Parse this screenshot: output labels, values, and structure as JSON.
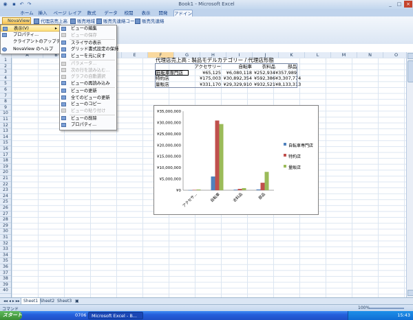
{
  "window": {
    "title": "Book1 - Microsoft Excel",
    "minimize_icon": "minimize-icon",
    "maximize_icon": "maximize-icon",
    "close_icon": "close-icon"
  },
  "ribbon_tabs": [
    "ホーム",
    "挿入",
    "ページ レイアウト",
    "数式",
    "データ",
    "校閲",
    "表示",
    "開発",
    "アドイン"
  ],
  "active_tab": "アドイン",
  "ribbon": {
    "novaview_button": "NovaView",
    "buttons": [
      "代理店売上高",
      "販売地域",
      "販売先連絡コード",
      "販売先連絡"
    ]
  },
  "menu_main": {
    "items": [
      {
        "label": "表示(V)",
        "has_submenu": true,
        "disabled": false
      },
      {
        "label": "プロパティ...",
        "has_submenu": false,
        "disabled": false
      },
      {
        "label": "クライアントのアップデート...",
        "has_submenu": false,
        "disabled": false
      },
      {
        "label": "NovaView のヘルプ",
        "has_submenu": false,
        "disabled": false
      }
    ]
  },
  "menu_sub": {
    "items": [
      {
        "label": "ビューの編集",
        "disabled": false
      },
      {
        "label": "ビューの保存",
        "disabled": true
      },
      {
        "label": "スライサの表示",
        "disabled": false
      },
      {
        "label": "グリッド書式設定の保持",
        "disabled": false
      },
      {
        "label": "ビューを元に戻す",
        "disabled": false
      },
      {
        "label": "パラメータ...",
        "disabled": true
      },
      {
        "label": "次の行を読み込む...",
        "disabled": true
      },
      {
        "label": "グラフの自動選択",
        "disabled": true
      },
      {
        "label": "ビューの再読み込み",
        "disabled": false
      },
      {
        "label": "ビューの更新",
        "disabled": false
      },
      {
        "label": "全てのビューの更新",
        "disabled": false
      },
      {
        "label": "ビューのコピー",
        "disabled": false
      },
      {
        "label": "ビューの貼り付け",
        "disabled": true
      },
      {
        "label": "ビューの削除",
        "disabled": false
      },
      {
        "label": "プロパティ...",
        "disabled": false
      }
    ]
  },
  "columns": [
    "A",
    "B",
    "C",
    "D",
    "E",
    "F",
    "G",
    "H",
    "I",
    "J",
    "K",
    "L",
    "M",
    "N",
    "O"
  ],
  "selected_column": "F",
  "rows": [
    "1",
    "2",
    "3",
    "4",
    "5",
    "6",
    "7",
    "8",
    "9",
    "10",
    "11",
    "12",
    "13",
    "14",
    "15",
    "16",
    "17",
    "18",
    "19",
    "20",
    "21",
    "22",
    "23",
    "24",
    "25",
    "26",
    "27",
    "28",
    "29",
    "30",
    "31",
    "32",
    "33",
    "34",
    "35",
    "36",
    "37",
    "38",
    "39",
    "40"
  ],
  "sheet_title": "代理店売上高 : 製品モデルカテゴリー / 代理店形態",
  "table": {
    "headers": [
      "アクセサリー",
      "自転車",
      "衣料品",
      "部品"
    ],
    "rows": [
      {
        "label": "自転車専門店",
        "values": [
          "¥65,125",
          "¥6,080,118",
          "¥252,934",
          "¥357,989"
        ]
      },
      {
        "label": "特約店",
        "values": [
          "¥175,003",
          "¥30,892,354",
          "¥592,386",
          "¥3,307,774"
        ]
      },
      {
        "label": "量販店",
        "values": [
          "¥331,170",
          "¥29,329,910",
          "¥932,521",
          "¥8,133,313"
        ]
      }
    ]
  },
  "chart_data": {
    "type": "bar",
    "categories": [
      "アクセサリー",
      "自転車",
      "衣料品",
      "部品"
    ],
    "series": [
      {
        "name": "自転車専門店",
        "values": [
          65125,
          6080118,
          252934,
          357989
        ],
        "color": "#4f81bd"
      },
      {
        "name": "特約店",
        "values": [
          175003,
          30892354,
          592386,
          3307774
        ],
        "color": "#c0504d"
      },
      {
        "name": "量販店",
        "values": [
          331170,
          29329910,
          932521,
          8133313
        ],
        "color": "#9bbb59"
      }
    ],
    "yticks": [
      "¥0",
      "¥5,000,000",
      "¥10,000,000",
      "¥15,000,000",
      "¥20,000,000",
      "¥25,000,000",
      "¥30,000,000",
      "¥35,000,000"
    ],
    "xtick_labels": [
      "アクセサ...",
      "自転車",
      "衣料品",
      "部品"
    ],
    "ylim": [
      0,
      35000000
    ],
    "legend_position": "right",
    "grid": false
  },
  "sheet_tabs": [
    "Sheet1",
    "Sheet2",
    "Sheet3"
  ],
  "active_sheet": "Sheet1",
  "status": {
    "mode": "コマンド",
    "zoom": "100%"
  },
  "taskbar": {
    "start_label": "スタート",
    "items": [
      "0706",
      "Microsoft Excel - B..."
    ],
    "clock": "15:43"
  }
}
